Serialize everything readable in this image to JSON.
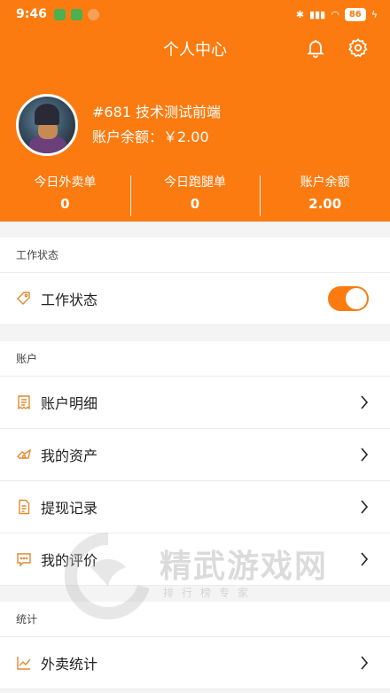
{
  "status_bar": {
    "time": "9:46",
    "battery": "86"
  },
  "header": {
    "title": "个人中心"
  },
  "profile": {
    "name": "#681 技术测试前端",
    "balance": "账户余额：￥2.00"
  },
  "stats": [
    {
      "label": "今日外卖单",
      "value": "0"
    },
    {
      "label": "今日跑腿单",
      "value": "0"
    },
    {
      "label": "账户余额",
      "value": "2.00"
    }
  ],
  "sections": {
    "work": {
      "title": "工作状态",
      "row_label": "工作状态",
      "toggle_on": true
    },
    "account": {
      "title": "账户",
      "items": [
        {
          "label": "账户明细",
          "icon": "receipt-icon"
        },
        {
          "label": "我的资产",
          "icon": "assets-icon"
        },
        {
          "label": "提现记录",
          "icon": "document-icon"
        },
        {
          "label": "我的评价",
          "icon": "comment-icon"
        }
      ]
    },
    "stats": {
      "title": "统计",
      "items": [
        {
          "label": "外卖统计",
          "icon": "line-chart-icon"
        }
      ]
    }
  },
  "watermark": {
    "title": "精武游戏网",
    "subtitle": "排行榜专家"
  },
  "colors": {
    "accent": "#fb7b10",
    "icon": "#e08a30"
  }
}
